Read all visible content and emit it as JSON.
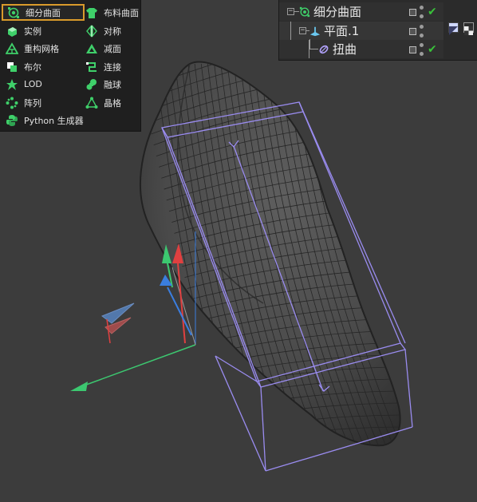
{
  "generator_menu": {
    "items_left": [
      {
        "label": "细分曲面",
        "icon": "subdivision-surface-icon",
        "selected": true
      },
      {
        "label": "实例",
        "icon": "instance-icon"
      },
      {
        "label": "重构网格",
        "icon": "remesh-icon"
      },
      {
        "label": "布尔",
        "icon": "boolean-icon"
      },
      {
        "label": "LOD",
        "icon": "lod-icon"
      },
      {
        "label": "阵列",
        "icon": "array-icon"
      },
      {
        "label": "Python 生成器",
        "icon": "python-generator-icon"
      }
    ],
    "items_right": [
      {
        "label": "布料曲面",
        "icon": "cloth-surface-icon"
      },
      {
        "label": "对称",
        "icon": "symmetry-icon"
      },
      {
        "label": "减面",
        "icon": "polygon-reduction-icon"
      },
      {
        "label": "连接",
        "icon": "connect-icon"
      },
      {
        "label": "融球",
        "icon": "metaball-icon"
      },
      {
        "label": "晶格",
        "icon": "atom-array-icon"
      }
    ],
    "accent_color": "#d99a2b",
    "icon_color": "#3fd06a"
  },
  "object_manager": {
    "rows": [
      {
        "name": "细分曲面",
        "icon": "subdivision-surface-icon",
        "expand": "−",
        "visible_check": "✔"
      },
      {
        "name": "平面.1",
        "icon": "plane-icon",
        "expand": "−"
      },
      {
        "name": "扭曲",
        "icon": "twist-deformer-icon",
        "visible_check": "✔"
      }
    ],
    "check_color": "#39c23a"
  },
  "viewport": {
    "background": "#3c3c3c",
    "object_color": "#505050",
    "wire_color": "#1e1e1e",
    "bbox_color": "#9a8cf0",
    "axis_x_color": "#e04040",
    "axis_y_color": "#3cc870",
    "axis_z_color": "#3a7ee0"
  }
}
